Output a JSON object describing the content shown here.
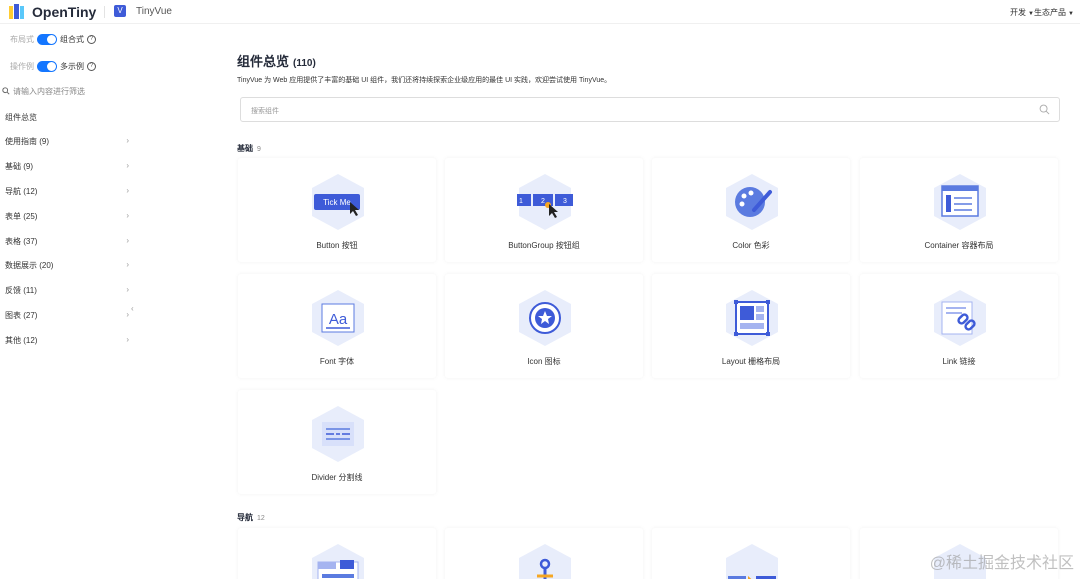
{
  "header": {
    "brand": "OpenTiny",
    "product_icon": "V",
    "product": "TinyVue",
    "nav": [
      {
        "label": "开发"
      },
      {
        "label": "生态产品"
      }
    ]
  },
  "sidebar": {
    "toggles": [
      {
        "label": "布局式",
        "value": "组合式"
      },
      {
        "label": "操作例",
        "value": "多示例"
      }
    ],
    "search_placeholder": "请输入内容进行筛选",
    "items": [
      {
        "label": "组件总览",
        "has_children": false
      },
      {
        "label": "使用指南 (9)",
        "has_children": true
      },
      {
        "label": "基础 (9)",
        "has_children": true
      },
      {
        "label": "导航 (12)",
        "has_children": true
      },
      {
        "label": "表单 (25)",
        "has_children": true
      },
      {
        "label": "表格 (37)",
        "has_children": true
      },
      {
        "label": "数据展示 (20)",
        "has_children": true
      },
      {
        "label": "反馈 (11)",
        "has_children": true
      },
      {
        "label": "图表 (27)",
        "has_children": true
      },
      {
        "label": "其他 (12)",
        "has_children": true
      }
    ]
  },
  "main": {
    "title": "组件总览",
    "count": "(110)",
    "description": "TinyVue 为 Web 应用提供了丰富的基础 UI 组件，我们还将持续探索企业级应用的最佳 UI 实践，欢迎尝试使用 TinyVue。",
    "search_placeholder": "搜索组件",
    "sections": [
      {
        "title": "基础",
        "count": "9",
        "cards": [
          {
            "label": "Button 按钮",
            "icon": "button-icon",
            "icon_text": "Tick Me"
          },
          {
            "label": "ButtonGroup 按钮组",
            "icon": "button-group-icon",
            "icon_text": "1 2 3"
          },
          {
            "label": "Color 色彩",
            "icon": "palette-icon"
          },
          {
            "label": "Container 容器布局",
            "icon": "container-icon"
          },
          {
            "label": "Font 字体",
            "icon": "font-icon",
            "icon_text": "Aa"
          },
          {
            "label": "Icon 图标",
            "icon": "star-icon"
          },
          {
            "label": "Layout 栅格布局",
            "icon": "layout-icon"
          },
          {
            "label": "Link 链接",
            "icon": "link-icon"
          },
          {
            "label": "Divider 分割线",
            "icon": "divider-icon"
          }
        ]
      },
      {
        "title": "导航",
        "count": "12"
      }
    ]
  },
  "watermark": "@稀土掘金技术社区",
  "colors": {
    "accent": "#1476ff",
    "icon_bg": "#e8edfb",
    "icon_main": "#5b7be0"
  }
}
